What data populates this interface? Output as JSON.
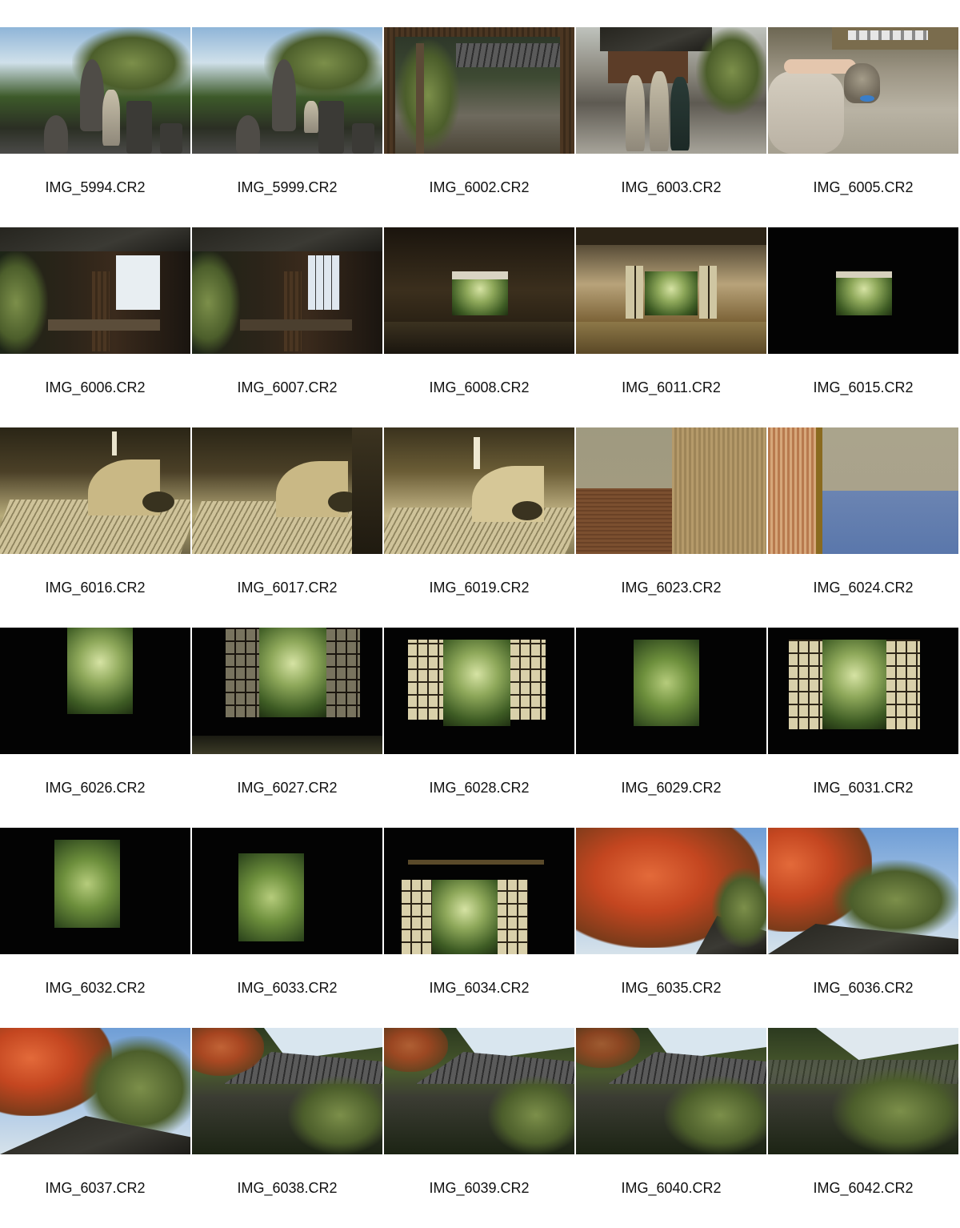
{
  "contact_sheet": {
    "thumbnails": [
      {
        "filename": "IMG_5994.CR2"
      },
      {
        "filename": "IMG_5999.CR2"
      },
      {
        "filename": "IMG_6002.CR2"
      },
      {
        "filename": "IMG_6003.CR2"
      },
      {
        "filename": "IMG_6005.CR2"
      },
      {
        "filename": "IMG_6006.CR2"
      },
      {
        "filename": "IMG_6007.CR2"
      },
      {
        "filename": "IMG_6008.CR2"
      },
      {
        "filename": "IMG_6011.CR2"
      },
      {
        "filename": "IMG_6015.CR2"
      },
      {
        "filename": "IMG_6016.CR2"
      },
      {
        "filename": "IMG_6017.CR2"
      },
      {
        "filename": "IMG_6019.CR2"
      },
      {
        "filename": "IMG_6023.CR2"
      },
      {
        "filename": "IMG_6024.CR2"
      },
      {
        "filename": "IMG_6026.CR2"
      },
      {
        "filename": "IMG_6027.CR2"
      },
      {
        "filename": "IMG_6028.CR2"
      },
      {
        "filename": "IMG_6029.CR2"
      },
      {
        "filename": "IMG_6031.CR2"
      },
      {
        "filename": "IMG_6032.CR2"
      },
      {
        "filename": "IMG_6033.CR2"
      },
      {
        "filename": "IMG_6034.CR2"
      },
      {
        "filename": "IMG_6035.CR2"
      },
      {
        "filename": "IMG_6036.CR2"
      },
      {
        "filename": "IMG_6037.CR2"
      },
      {
        "filename": "IMG_6038.CR2"
      },
      {
        "filename": "IMG_6039.CR2"
      },
      {
        "filename": "IMG_6040.CR2"
      },
      {
        "filename": "IMG_6042.CR2"
      }
    ]
  }
}
